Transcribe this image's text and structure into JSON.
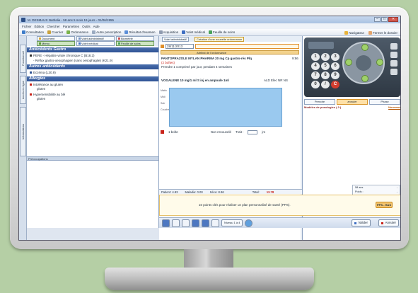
{
  "window": {
    "title": "M. DESMAUX Nathalie - 58 ans 5 mois 19 jours - 01/06/1955"
  },
  "menu": [
    "Fichier",
    "Édition",
    "Chercher",
    "Paramètres",
    "Outils",
    "Aide"
  ],
  "toolbar": {
    "items": [
      "Consultation",
      "Courrier",
      "Ordonnance",
      "Autre prescription",
      "Résultat d'examen",
      "Acquisition",
      "Volet médical",
      "Feuille de soins"
    ],
    "right": [
      "Navigateur",
      "Fermer le dossier"
    ]
  },
  "vertical_tabs": [
    "Fonctionnel",
    "Accès en ligne",
    "Informations"
  ],
  "left_panel": {
    "tabs_row1": [
      "Document",
      "Volet administratif",
      "Biométrie"
    ],
    "tabs_row2": [
      "Mémo",
      "Volet médical",
      "Feuille de soins"
    ],
    "antecedents_title": "Antécédents Gastro",
    "antecedents": [
      "PERE - Hépatite virale chronique C (B18.2)",
      "- Reflux gastro-oesophagien (sans oesophagite) (K21.9)"
    ],
    "autres_title": "Autres antécédents",
    "autres": [
      "Eczéma (L30.9)"
    ],
    "allergies_title": "Allergies",
    "allergies": [
      {
        "name": "Intolérance au gluten",
        "detail": "gluten"
      },
      {
        "name": "Hypersensibilité au blé",
        "detail": "gluten"
      }
    ],
    "preoccupations_label": "Préoccupations"
  },
  "middle_panel": {
    "tabs": [
      "Volet administratif",
      "Création d'une nouvelle ordonnance"
    ],
    "date": "28/11/2013",
    "header": "Attribut de l'ordonnance",
    "prescriptions": [
      {
        "drug": "PANTOPRAZOLE MYLAN PHARMA 20 mg Cp gastro-rés Plq",
        "flag": "(2 boîtes)",
        "posology": "Prendre 1 comprimé par jour, pendant 4 semaines",
        "time": "9:56"
      },
      {
        "drug": "VOGALENE 10 mg/1 ml S inj en ampoule 1ml",
        "codes": "ALD Elec NR NS"
      }
    ],
    "side_labels": [
      "Matin",
      "Midi",
      "Soir",
      "Coucher"
    ],
    "qty": {
      "boxes": "1 boîte",
      "renewal": "Non renouvelé",
      "treatment": "Trait :",
      "unit": "jrs"
    },
    "totals": [
      "Patient: 4.83",
      "Maladie: 0.00",
      "Sécu: 8.96",
      "Total:",
      "13.78"
    ]
  },
  "right_panel": {
    "keys": [
      "1",
      "2",
      "3",
      "4",
      "5",
      "6",
      "7",
      "8",
      "9",
      "0",
      "/",
      "C"
    ],
    "tabs": [
      "Prendre",
      "annuler",
      "Phase"
    ],
    "modeles_title": "Modèles de posologies ( 0 )",
    "modeles_link": "Nouveau",
    "vitals": [
      {
        "label": "58 ans",
        "value": "-"
      },
      {
        "label": "Poids :",
        "value": "-"
      },
      {
        "label": "DFG :",
        "value": "-"
      },
      {
        "label": "Homme",
        "value": "-"
      },
      {
        "label": "Taille :",
        "value": "-"
      }
    ]
  },
  "footer": {
    "pps_text": "10 points clés pour réaliser un plan personnalisé de santé (PPS).",
    "pps_button": "PPS - HAS"
  },
  "bottom_bar": {
    "level": "Niveau 1 à 4",
    "validate": "Valider",
    "cancel": "Annuler"
  }
}
